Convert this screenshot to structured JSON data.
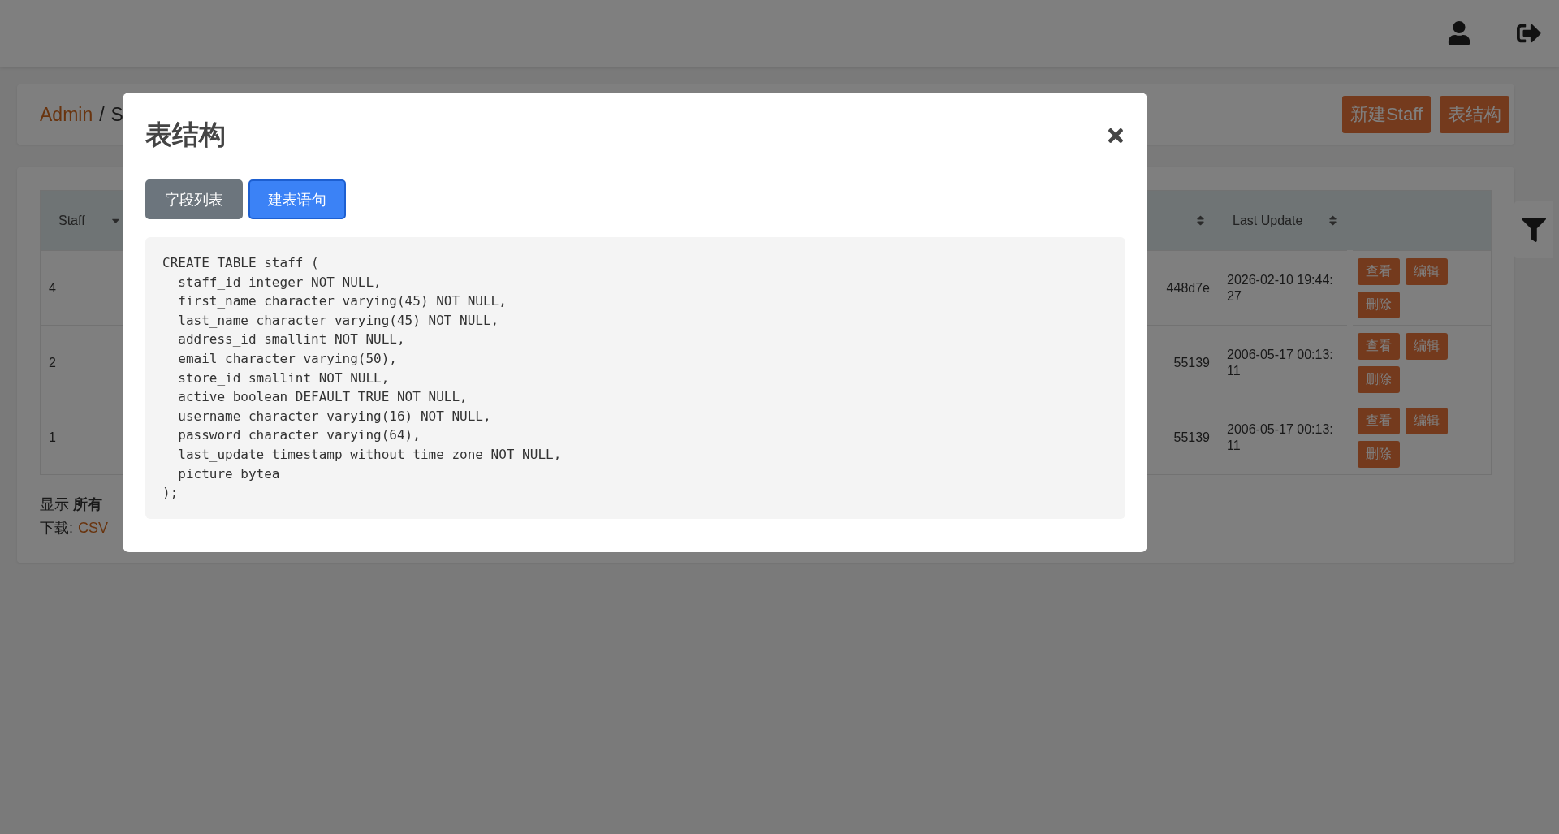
{
  "breadcrumb": {
    "root": "Admin",
    "separator": "/",
    "current": "S"
  },
  "toolbar_buttons": [
    "新建Staff",
    "表结构"
  ],
  "table": {
    "columns": [
      {
        "label": "Staff",
        "sorted": true
      },
      {
        "sorted": false
      },
      {
        "label": "Last Update",
        "sorted": false
      }
    ],
    "rows": [
      {
        "column_1": "4",
        "column_3": "448d7e",
        "last_update": "2026-02-10 19:44:27",
        "actions": [
          "查看",
          "编辑",
          "删除"
        ]
      },
      {
        "column_1": "2",
        "column_3": "55139",
        "last_update": "2006-05-17 00:13:11",
        "actions": [
          "查看",
          "编辑",
          "删除"
        ]
      },
      {
        "column_1": "1",
        "column_3": "55139",
        "last_update": "2006-05-17 00:13:11",
        "actions": [
          "查看",
          "编辑",
          "删除"
        ]
      }
    ]
  },
  "footer": {
    "summary": "显示 **所有**",
    "download_label": "下载:",
    "download_links": [
      "CSV"
    ]
  },
  "modal": {
    "title": "表结构",
    "tabs": [
      {
        "label": "字段列表",
        "selected": false
      },
      {
        "label": "建表语句",
        "selected": true
      }
    ],
    "code": "CREATE TABLE staff (\n  staff_id integer NOT NULL,\n  first_name character varying(45) NOT NULL,\n  last_name character varying(45) NOT NULL,\n  address_id smallint NOT NULL,\n  email character varying(50),\n  store_id smallint NOT NULL,\n  active boolean DEFAULT TRUE NOT NULL,\n  username character varying(16) NOT NULL,\n  password character varying(64),\n  last_update timestamp without time zone NOT NULL,\n  picture bytea\n);"
  }
}
